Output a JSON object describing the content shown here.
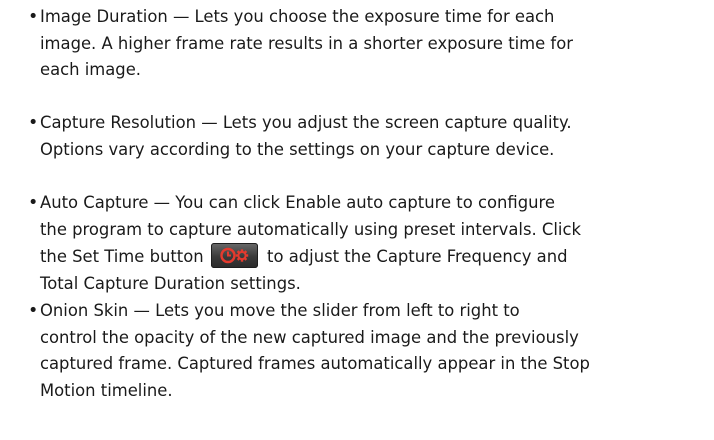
{
  "bullet_char": "•",
  "items": [
    {
      "lines": [
        [
          {
            "t": "Image Duration",
            "term": true
          },
          {
            "t": " — Lets you choose the exposure time for each"
          }
        ],
        [
          {
            "t": "image. A higher frame rate results in a shorter exposure time for"
          }
        ],
        [
          {
            "t": "each image."
          }
        ]
      ]
    },
    {
      "lines": [
        [
          {
            "t": "Capture Resolution",
            "term": true
          },
          {
            "t": " — Lets you adjust the screen capture quality."
          }
        ],
        [
          {
            "t": "Options vary according to the settings on your capture device."
          }
        ]
      ]
    },
    {
      "lines": [
        [
          {
            "t": "Auto Capture",
            "term": true
          },
          {
            "t": " — You can click "
          },
          {
            "t": "Enable auto capture",
            "term": true
          },
          {
            "t": " to configure"
          }
        ],
        [
          {
            "t": "the program to capture automatically using preset intervals. Click"
          }
        ],
        [
          {
            "t": "the "
          },
          {
            "t": "Set Time",
            "term": true
          },
          {
            "t": " button "
          },
          {
            "icon": "set-time-clock-gear-icon"
          },
          {
            "t": " to adjust the "
          },
          {
            "t": "Capture Frequency",
            "term": true
          },
          {
            "t": " and"
          }
        ],
        [
          {
            "t": "Total Capture Duration",
            "term": true
          },
          {
            "t": " settings."
          }
        ]
      ]
    },
    {
      "lines": [
        [
          {
            "t": "Onion Skin",
            "term": true
          },
          {
            "t": " — Lets you move the slider from left to right to"
          }
        ],
        [
          {
            "t": "control the opacity of the new captured image and the previously"
          }
        ],
        [
          {
            "t": "captured frame. Captured frames automatically appear in the Stop"
          }
        ],
        [
          {
            "t": "Motion timeline."
          }
        ]
      ]
    }
  ],
  "icons": {
    "set-time-clock-gear-icon": {
      "button_bg": "#3a3a3a",
      "glyph_color": "#e63a2e"
    }
  }
}
